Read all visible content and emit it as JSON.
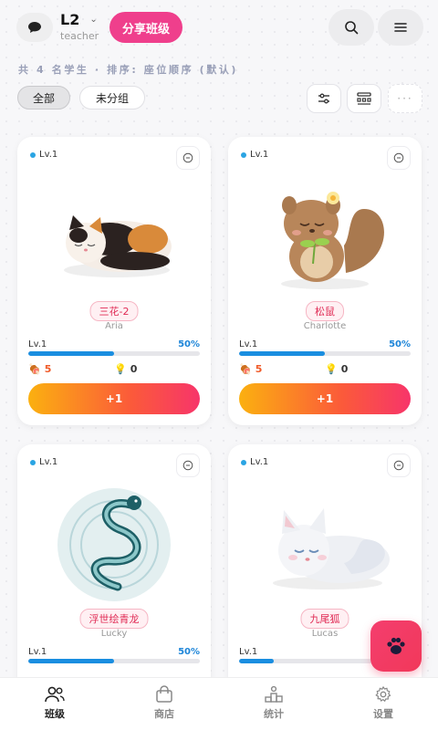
{
  "header": {
    "class_name": "L2",
    "role": "teacher",
    "share_label": "分享班级"
  },
  "summary": {
    "text": "共 4 名学生 · 排序: 座位顺序 (默认)"
  },
  "filters": {
    "all_label": "全部",
    "ungrouped_label": "未分组"
  },
  "students": [
    {
      "level": "Lv.1",
      "pet_label": "三花-2",
      "name": "Aria",
      "level_label": "Lv.1",
      "progress_text": "50%",
      "progress": 0.5,
      "food": "5",
      "likes": "0",
      "plus_label": "+1"
    },
    {
      "level": "Lv.1",
      "pet_label": "松鼠",
      "name": "Charlotte",
      "level_label": "Lv.1",
      "progress_text": "50%",
      "progress": 0.5,
      "food": "5",
      "likes": "0",
      "plus_label": "+1"
    },
    {
      "level": "Lv.1",
      "pet_label": "浮世绘青龙",
      "name": "Lucky",
      "level_label": "Lv.1",
      "progress_text": "50%",
      "progress": 0.5
    },
    {
      "level": "Lv.1",
      "pet_label": "九尾狐",
      "name": "Lucas",
      "level_label": "Lv.1",
      "progress": 0.2
    }
  ],
  "nav": [
    {
      "label": "班级",
      "icon": "users-icon"
    },
    {
      "label": "商店",
      "icon": "shopping-bag-icon"
    },
    {
      "label": "统计",
      "icon": "podium-icon"
    },
    {
      "label": "设置",
      "icon": "gear-icon"
    }
  ],
  "colors": {
    "accent_pink": "#ef3f8c",
    "progress_blue": "#1a8ee0",
    "tag_red": "#e02b55"
  }
}
